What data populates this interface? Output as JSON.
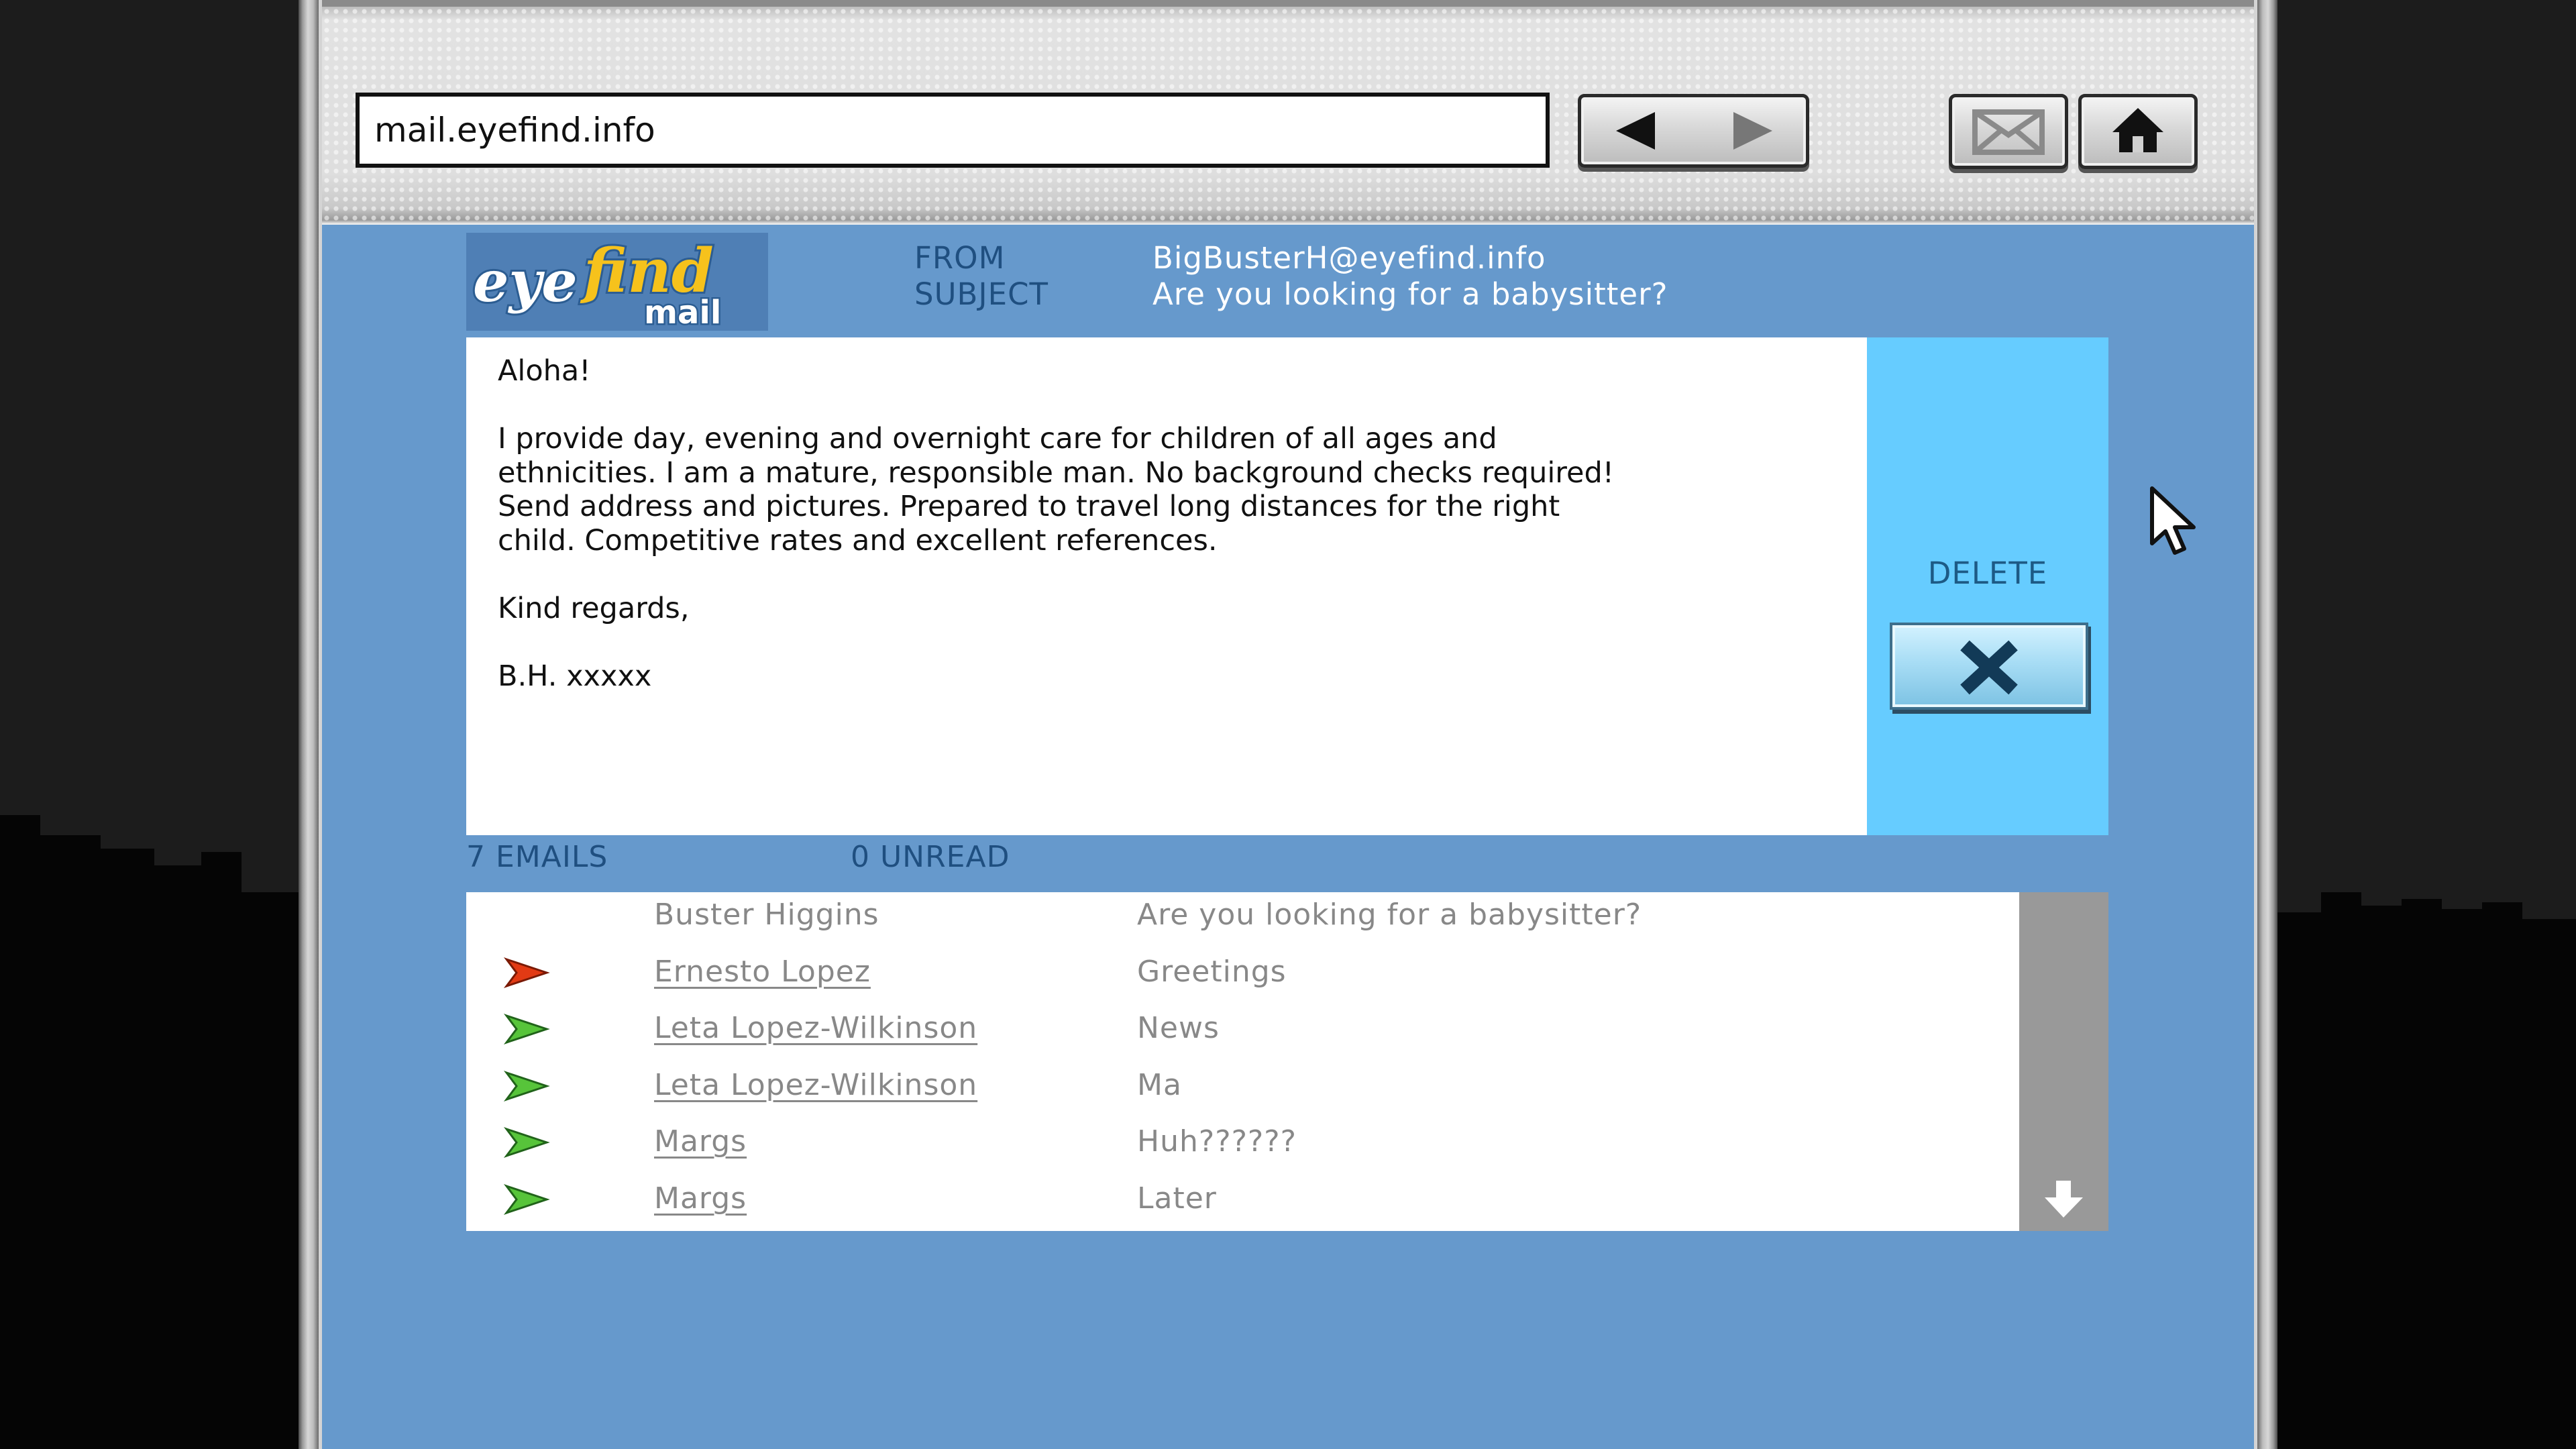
{
  "browser": {
    "url": "mail.eyefind.info"
  },
  "logo": {
    "word1": "eye",
    "word2": "find",
    "word3": "mail"
  },
  "header": {
    "from_label": "FROM",
    "subject_label": "SUBJECT",
    "from_value": "BigBusterH@eyefind.info",
    "subject_value": "Are you looking for a babysitter?"
  },
  "message": {
    "greeting": "Aloha!",
    "body_lines": [
      "I provide day, evening and overnight care for children of all ages and",
      "ethnicities. I am a mature, responsible man. No background checks required!",
      "Send address and pictures. Prepared to travel long distances for the right",
      "child. Competitive rates and excellent references."
    ],
    "closing": "Kind regards,",
    "signature": "B.H. xxxxx"
  },
  "actions": {
    "delete_label": "DELETE"
  },
  "inbox": {
    "total": "7 EMAILS",
    "unread": "0 UNREAD",
    "emails": [
      {
        "sender": "Buster Higgins",
        "subject": "Are you looking for a babysitter?",
        "icon": "none"
      },
      {
        "sender": "Ernesto Lopez",
        "subject": "Greetings",
        "icon": "red-arrow-icon"
      },
      {
        "sender": "Leta Lopez-Wilkinson",
        "subject": "News",
        "icon": "green-arrow-icon"
      },
      {
        "sender": "Leta Lopez-Wilkinson",
        "subject": "Ma",
        "icon": "green-arrow-icon"
      },
      {
        "sender": "Margs",
        "subject": "Huh??????",
        "icon": "green-arrow-icon"
      },
      {
        "sender": "Margs",
        "subject": "Later",
        "icon": "green-arrow-icon"
      }
    ]
  },
  "colors": {
    "page_bg": "#6699cc",
    "panel": "#66ccff",
    "label": "#1f4f80"
  }
}
